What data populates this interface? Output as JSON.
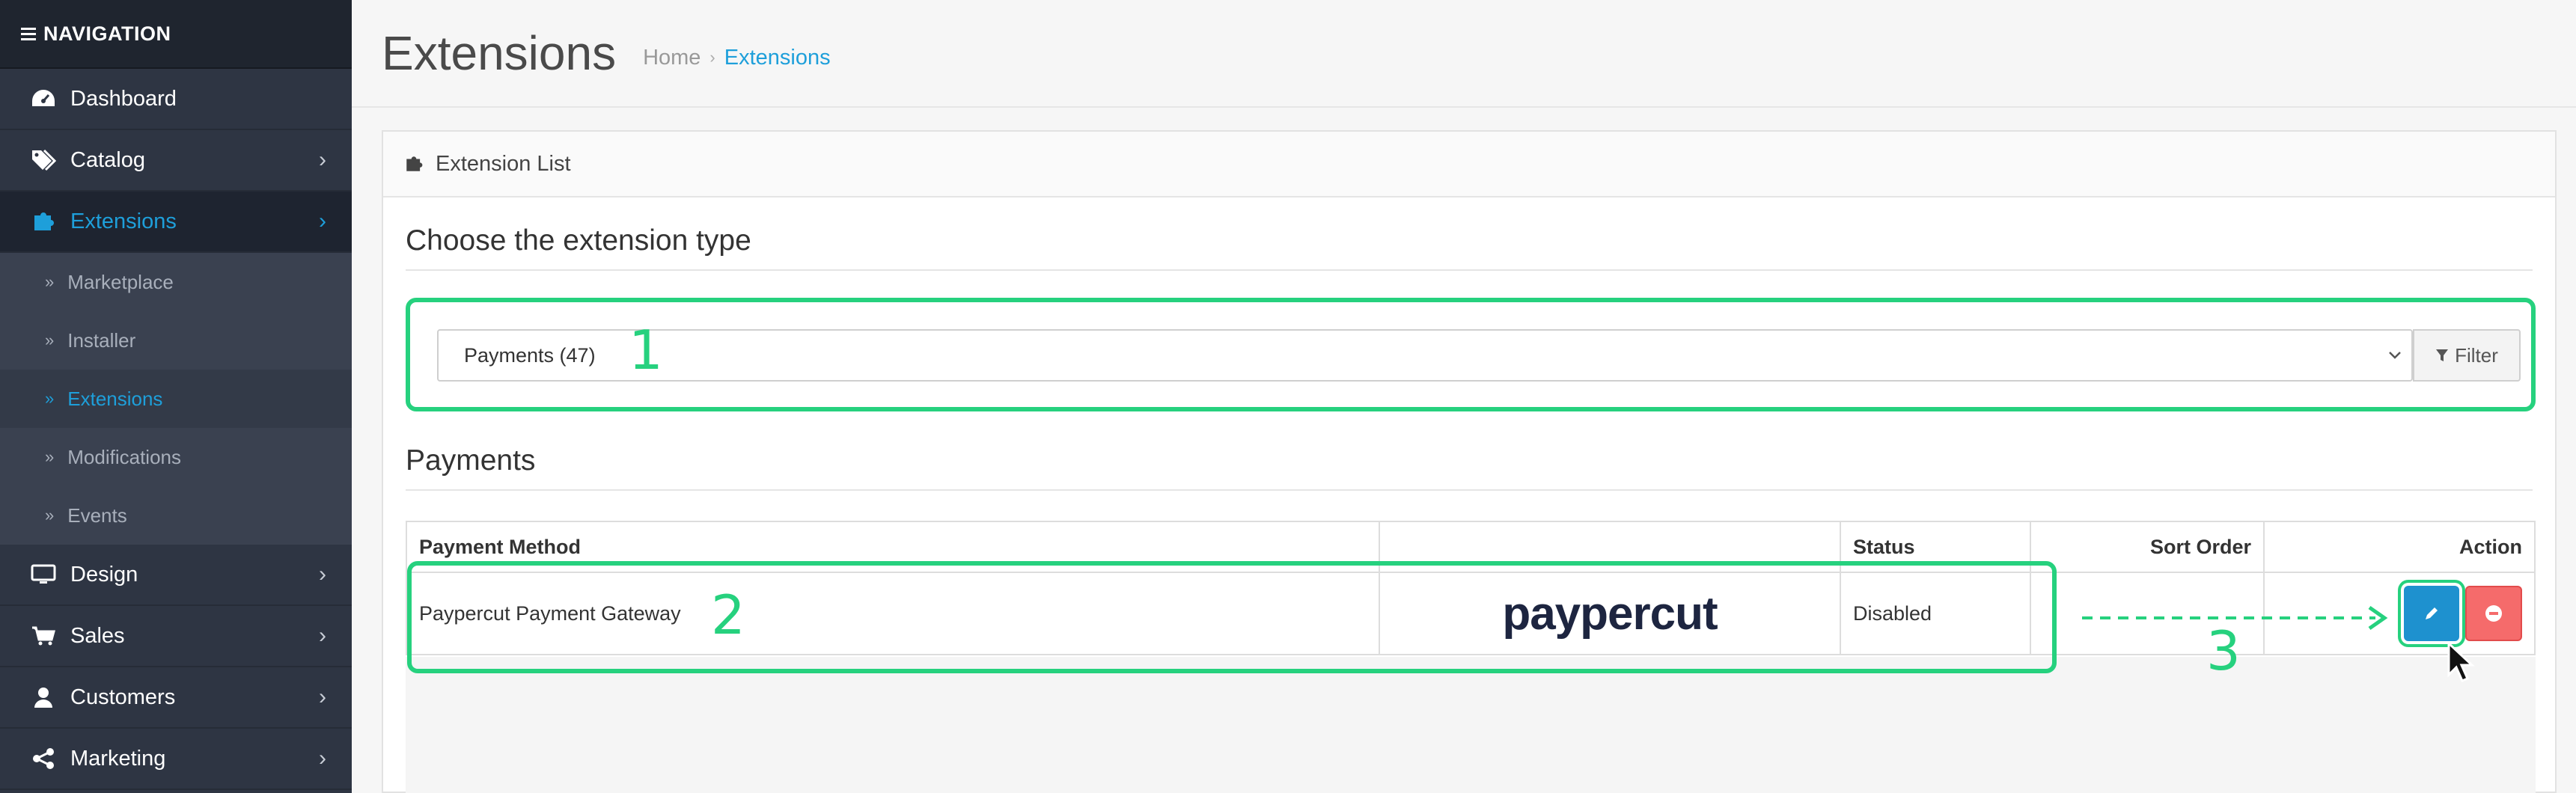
{
  "sidebar": {
    "header": "NAVIGATION",
    "items": [
      {
        "label": "Dashboard",
        "icon": "dashboard-icon"
      },
      {
        "label": "Catalog",
        "icon": "tags-icon"
      },
      {
        "label": "Extensions",
        "icon": "puzzle-icon"
      },
      {
        "label": "Design",
        "icon": "monitor-icon"
      },
      {
        "label": "Sales",
        "icon": "cart-icon"
      },
      {
        "label": "Customers",
        "icon": "user-icon"
      },
      {
        "label": "Marketing",
        "icon": "share-icon"
      }
    ],
    "subitems": [
      {
        "label": "Marketplace"
      },
      {
        "label": "Installer"
      },
      {
        "label": "Extensions"
      },
      {
        "label": "Modifications"
      },
      {
        "label": "Events"
      }
    ]
  },
  "header": {
    "title": "Extensions",
    "breadcrumb": [
      "Home",
      "Extensions"
    ]
  },
  "panel": {
    "heading": "Extension List",
    "choose_title": "Choose the extension type",
    "select_value": "Payments (47)",
    "filter_label": "Filter",
    "payments_title": "Payments"
  },
  "table": {
    "headers": [
      "Payment Method",
      "",
      "Status",
      "Sort Order",
      "Action"
    ],
    "rows": [
      {
        "method": "Paypercut Payment Gateway",
        "logo": "paypercut",
        "status": "Disabled",
        "sort_order": ""
      }
    ]
  },
  "annotations": [
    "1",
    "2",
    "3"
  ],
  "colors": {
    "accent": "#1e9fda",
    "highlight": "#26d17e",
    "edit_button": "#1e91cf",
    "delete_button": "#f56b6b"
  }
}
